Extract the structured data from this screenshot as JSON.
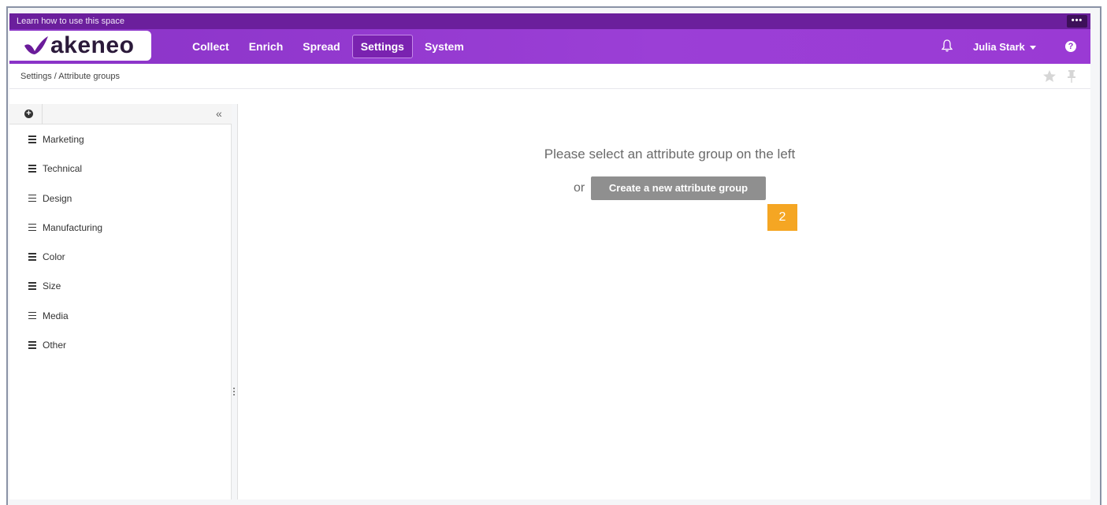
{
  "learn_bar": {
    "text": "Learn how to use this space",
    "more_label": "•••"
  },
  "header": {
    "logo_text": "akeneo",
    "nav": [
      {
        "label": "Collect"
      },
      {
        "label": "Enrich"
      },
      {
        "label": "Spread"
      },
      {
        "label": "Settings",
        "active": true
      },
      {
        "label": "System"
      }
    ],
    "user_name": "Julia Stark",
    "help_label": "?"
  },
  "breadcrumb": {
    "text": "Settings / Attribute groups"
  },
  "sidebar": {
    "add_label": "+",
    "collapse_label": "«",
    "groups": [
      {
        "label": "Marketing"
      },
      {
        "label": "Technical"
      },
      {
        "label": "Design"
      },
      {
        "label": "Manufacturing"
      },
      {
        "label": "Color"
      },
      {
        "label": "Size"
      },
      {
        "label": "Media"
      },
      {
        "label": "Other"
      }
    ]
  },
  "main": {
    "empty_message": "Please select an attribute group on the left",
    "or_text": "or",
    "create_button_label": "Create a new attribute group",
    "step_badge": "2"
  },
  "colors": {
    "brand": "#9b3fd6",
    "learn_bar": "#6b1f9c",
    "button_gray": "#8f8f8f",
    "badge": "#f5a623"
  }
}
